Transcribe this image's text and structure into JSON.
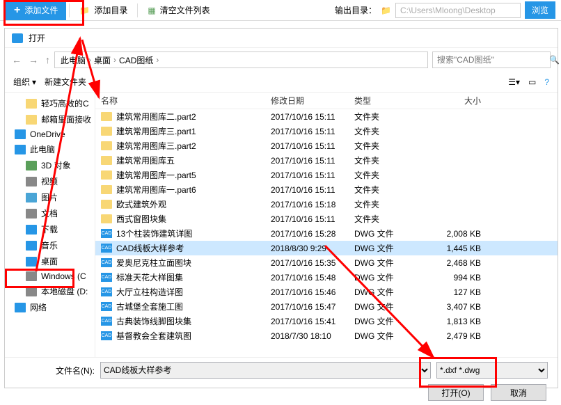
{
  "toolbar": {
    "add_file": "添加文件",
    "add_dir": "添加目录",
    "clear_list": "清空文件列表",
    "output_label": "输出目录：",
    "output_path": "C:\\Users\\Mloong\\Desktop",
    "browse": "浏览"
  },
  "dialog": {
    "title": "打开",
    "breadcrumb": [
      "此电脑",
      "桌面",
      "CAD图纸"
    ],
    "search_placeholder": "搜索\"CAD图纸\"",
    "organize": "组织",
    "new_folder": "新建文件夹",
    "columns": {
      "name": "名称",
      "date": "修改日期",
      "type": "类型",
      "size": "大小"
    },
    "filename_label": "文件名(N):",
    "filename_value": "CAD线板大样参考",
    "filetype": "*.dxf *.dwg",
    "open_btn": "打开(O)",
    "cancel_btn": "取消"
  },
  "sidebar": [
    {
      "label": "轻巧高效的C",
      "icon": "folder"
    },
    {
      "label": "邮箱里面接收",
      "icon": "folder"
    },
    {
      "label": "OneDrive",
      "icon": "blue",
      "indent": "less"
    },
    {
      "label": "此电脑",
      "icon": "blue",
      "indent": "less"
    },
    {
      "label": "3D 对象",
      "icon": "green"
    },
    {
      "label": "视频",
      "icon": "gray"
    },
    {
      "label": "图片",
      "icon": "pic"
    },
    {
      "label": "文档",
      "icon": "gray"
    },
    {
      "label": "下载",
      "icon": "blue"
    },
    {
      "label": "音乐",
      "icon": "blue"
    },
    {
      "label": "桌面",
      "icon": "blue"
    },
    {
      "label": "Windows (C",
      "icon": "gray"
    },
    {
      "label": "本地磁盘 (D:",
      "icon": "gray"
    },
    {
      "label": "网络",
      "icon": "blue",
      "indent": "less"
    }
  ],
  "files": [
    {
      "name": "建筑常用图库二.part2",
      "date": "2017/10/16 15:11",
      "type": "文件夹",
      "size": "",
      "icon": "folder"
    },
    {
      "name": "建筑常用图库三.part1",
      "date": "2017/10/16 15:11",
      "type": "文件夹",
      "size": "",
      "icon": "folder"
    },
    {
      "name": "建筑常用图库三.part2",
      "date": "2017/10/16 15:11",
      "type": "文件夹",
      "size": "",
      "icon": "folder"
    },
    {
      "name": "建筑常用图库五",
      "date": "2017/10/16 15:11",
      "type": "文件夹",
      "size": "",
      "icon": "folder"
    },
    {
      "name": "建筑常用图库一.part5",
      "date": "2017/10/16 15:11",
      "type": "文件夹",
      "size": "",
      "icon": "folder"
    },
    {
      "name": "建筑常用图库一.part6",
      "date": "2017/10/16 15:11",
      "type": "文件夹",
      "size": "",
      "icon": "folder"
    },
    {
      "name": "欧式建筑外观",
      "date": "2017/10/16 15:18",
      "type": "文件夹",
      "size": "",
      "icon": "folder"
    },
    {
      "name": "西式窗图块集",
      "date": "2017/10/16 15:11",
      "type": "文件夹",
      "size": "",
      "icon": "folder"
    },
    {
      "name": "13个柱装饰建筑详图",
      "date": "2017/10/16 15:28",
      "type": "DWG 文件",
      "size": "2,008 KB",
      "icon": "dwg"
    },
    {
      "name": "CAD线板大样参考",
      "date": "2018/8/30 9:29",
      "type": "DWG 文件",
      "size": "1,445 KB",
      "icon": "dwg",
      "selected": true
    },
    {
      "name": "爱奥尼克柱立面图块",
      "date": "2017/10/16 15:35",
      "type": "DWG 文件",
      "size": "2,468 KB",
      "icon": "dwg"
    },
    {
      "name": "标准天花大样图集",
      "date": "2017/10/16 15:48",
      "type": "DWG 文件",
      "size": "994 KB",
      "icon": "dwg"
    },
    {
      "name": "大厅立柱构造详图",
      "date": "2017/10/16 15:46",
      "type": "DWG 文件",
      "size": "127 KB",
      "icon": "dwg"
    },
    {
      "name": "古城堡全套施工图",
      "date": "2017/10/16 15:47",
      "type": "DWG 文件",
      "size": "3,407 KB",
      "icon": "dwg"
    },
    {
      "name": "古典装饰线脚图块集",
      "date": "2017/10/16 15:41",
      "type": "DWG 文件",
      "size": "1,813 KB",
      "icon": "dwg"
    },
    {
      "name": "基督教会全套建筑图",
      "date": "2018/7/30 18:10",
      "type": "DWG 文件",
      "size": "2,479 KB",
      "icon": "dwg"
    }
  ]
}
